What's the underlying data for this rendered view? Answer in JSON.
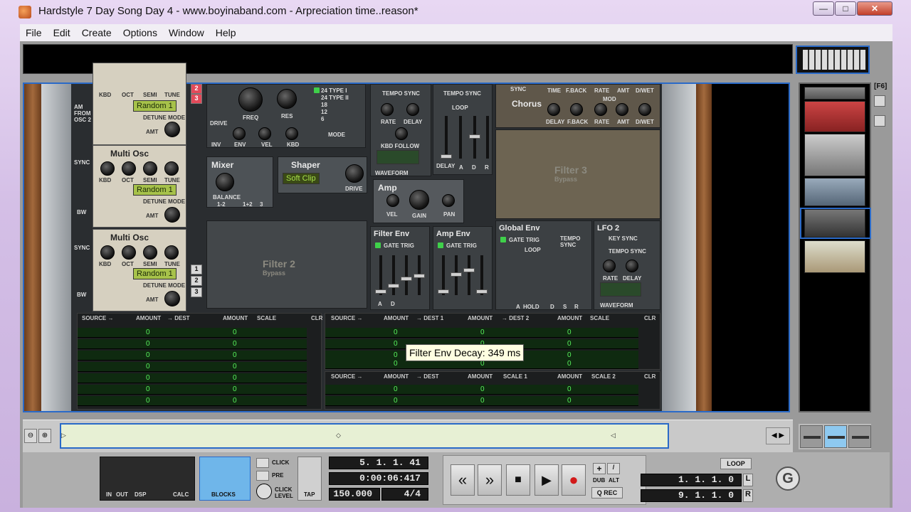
{
  "window": {
    "title": "Hardstyle 7 Day Song Day 4 - www.boyinaband.com - Arpreciation time..reason*",
    "min_label": "—",
    "max_label": "□",
    "close_label": "✕"
  },
  "menu": [
    "File",
    "Edit",
    "Create",
    "Options",
    "Window",
    "Help"
  ],
  "synth": {
    "osc_labels": {
      "kbd": "KBD",
      "oct": "OCT",
      "semi": "SEMI",
      "tune": "TUNE",
      "detune_mode": "DETUNE MODE",
      "amt": "AMT",
      "am_from_osc2": "AM FROM OSC 2",
      "sync": "SYNC",
      "bw": "BW"
    },
    "osc_random": [
      "Random 1",
      "Random 1",
      "Random 1"
    ],
    "multi_osc": "Multi Osc",
    "filter": {
      "freq": "FREQ",
      "res": "RES",
      "drive": "DRIVE",
      "inv": "INV",
      "env": "ENV",
      "vel": "VEL",
      "kbd": "KBD",
      "mode": "MODE",
      "types": [
        "24 TYPE I",
        "24 TYPE II",
        "18",
        "12",
        "6"
      ]
    },
    "mixer": {
      "title": "Mixer",
      "balance": "BALANCE",
      "b12": "1-2",
      "b1p2": "1+2",
      "b3": "3"
    },
    "shaper": {
      "title": "Shaper",
      "mode": "Soft Clip",
      "drive": "DRIVE"
    },
    "lfo1": {
      "tempo_sync": "TEMPO SYNC",
      "rate": "RATE",
      "delay": "DELAY",
      "kbd_follow": "KBD FOLLOW",
      "waveform": "WAVEFORM"
    },
    "mod_env": {
      "tempo_sync": "TEMPO SYNC",
      "loop": "LOOP",
      "delay": "DELAY",
      "a": "A",
      "d": "D",
      "r": "R"
    },
    "amp": {
      "title": "Amp",
      "vel": "VEL",
      "gain": "GAIN",
      "pan": "PAN"
    },
    "filter2": {
      "name": "Filter 2",
      "bypass": "Bypass"
    },
    "filter3": {
      "name": "Filter 3",
      "bypass": "Bypass"
    },
    "filter_env": {
      "title": "Filter Env",
      "gate_trig": "GATE TRIG",
      "a": "A",
      "d": "D"
    },
    "amp_env": {
      "title": "Amp Env",
      "gate_trig": "GATE TRIG"
    },
    "chorus": {
      "title": "Chorus",
      "delay": "DELAY",
      "fback": "F.BACK",
      "rate": "RATE",
      "amt": "AMT",
      "dwet": "D/WET",
      "mod": "MOD"
    },
    "delay_fx": {
      "sync": "SYNC",
      "time": "TIME",
      "fback": "F.BACK",
      "rate": "RATE",
      "amt": "AMT",
      "dwet": "D/WET"
    },
    "global_env": {
      "title": "Global Env",
      "gate_trig": "GATE TRIG",
      "tempo_sync": "TEMPO SYNC",
      "loop": "LOOP",
      "a": "A",
      "hold": "HOLD",
      "d": "D",
      "s": "S",
      "r": "R"
    },
    "lfo2": {
      "title": "LFO 2",
      "key_sync": "KEY SYNC",
      "tempo_sync": "TEMPO SYNC",
      "rate": "RATE",
      "delay": "DELAY",
      "waveform": "WAVEFORM"
    },
    "slot_buttons_top": [
      "2",
      "3"
    ],
    "slot_buttons_bottom": [
      "1",
      "2",
      "3"
    ]
  },
  "matrix": {
    "left": {
      "headers": [
        "SOURCE →",
        "AMOUNT",
        "→ DEST",
        "AMOUNT",
        "SCALE"
      ],
      "clr": "CLR",
      "rows": [
        [
          "0",
          "0"
        ],
        [
          "0",
          "0"
        ],
        [
          "0",
          "0"
        ],
        [
          "0",
          "0"
        ],
        [
          "0",
          "0"
        ],
        [
          "0",
          "0"
        ],
        [
          "0",
          "0"
        ]
      ]
    },
    "right_top": {
      "headers": [
        "SOURCE →",
        "AMOUNT",
        "→ DEST 1",
        "AMOUNT",
        "→ DEST 2",
        "AMOUNT",
        "SCALE"
      ],
      "clr": "CLR",
      "rows": [
        [
          "0",
          "0",
          "0"
        ],
        [
          "0",
          "0",
          "0"
        ],
        [
          "0",
          "0",
          "0"
        ],
        [
          "0",
          "0",
          "0"
        ]
      ]
    },
    "right_bottom": {
      "headers": [
        "SOURCE →",
        "AMOUNT",
        "→ DEST",
        "AMOUNT",
        "SCALE 1",
        "AMOUNT",
        "SCALE 2"
      ],
      "clr": "CLR",
      "rows": [
        [
          "0",
          "0",
          "0"
        ],
        [
          "0",
          "0",
          "0"
        ]
      ]
    }
  },
  "tooltip": "Filter Env Decay: 349 ms",
  "sidebar": {
    "f6": "[F6]"
  },
  "transport": {
    "meter": {
      "in": "IN",
      "out": "OUT",
      "dsp": "DSP",
      "calc": "CALC"
    },
    "blocks": "BLOCKS",
    "click": "CLICK",
    "pre": "PRE",
    "click_level": "CLICK LEVEL",
    "tap": "TAP",
    "position": "5. 1. 1. 41",
    "time": "0:00:06:417",
    "tempo": "150.000",
    "signature": "4/4",
    "rewind": "«",
    "forward": "»",
    "stop": "■",
    "play": "▶",
    "record": "●",
    "plus": "+",
    "dub": "DUB",
    "alt": "ALT",
    "q_rec": "Q REC",
    "loop": "LOOP",
    "left_locator": "1. 1. 1. 0",
    "right_locator": "9. 1. 1. 0",
    "l": "L",
    "r": "R",
    "logo": "G"
  },
  "colors": {
    "accent": "#2a6ac8",
    "lcd_green": "#a7c24a",
    "matrix_text": "#58f25c",
    "record": "#d21a1a"
  }
}
